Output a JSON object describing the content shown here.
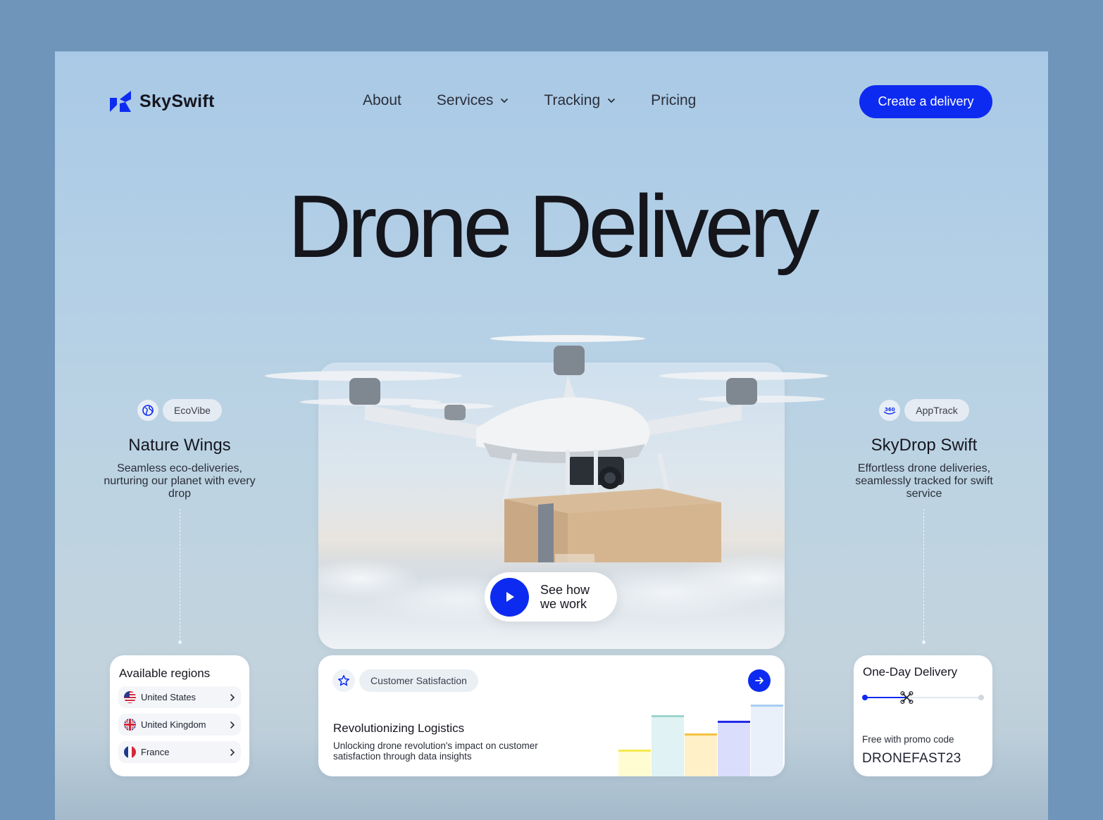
{
  "brand": {
    "name": "SkySwift",
    "accent": "#0D2BF0"
  },
  "nav": {
    "items": [
      {
        "label": "About",
        "has_dropdown": false
      },
      {
        "label": "Services",
        "has_dropdown": true
      },
      {
        "label": "Tracking",
        "has_dropdown": true
      },
      {
        "label": "Pricing",
        "has_dropdown": false
      }
    ],
    "cta_label": "Create a delivery"
  },
  "hero": {
    "title": "Drone Delivery",
    "play_text_line1": "See how",
    "play_text_line2": "we work"
  },
  "left_feature": {
    "chip": "EcoVibe",
    "icon": "globe-icon",
    "title": "Nature Wings",
    "description": "Seamless eco-deliveries, nurturing our planet with every drop"
  },
  "right_feature": {
    "chip": "AppTrack",
    "icon": "360-icon",
    "title": "SkyDrop Swift",
    "description": "Effortless drone deliveries, seamlessly tracked for swift service"
  },
  "regions": {
    "title": "Available regions",
    "items": [
      {
        "label": "United States",
        "flag": "us-flag-icon"
      },
      {
        "label": "United Kingdom",
        "flag": "uk-flag-icon"
      },
      {
        "label": "France",
        "flag": "fr-flag-icon"
      }
    ]
  },
  "logistics": {
    "chip": "Customer Satisfaction",
    "title": "Revolutionizing Logistics",
    "description": "Unlocking drone revolution's impact on customer satisfaction through data insights",
    "bar_colors": [
      "#FFFCD2",
      "#E0F2F3",
      "#FFF0C8",
      "#DADDFC",
      "#E9F0FA"
    ],
    "bar_accents": [
      "#F5E94E",
      "#9ED3CC",
      "#F2C240",
      "#2329E8",
      "#A9CDF0"
    ]
  },
  "delivery": {
    "title": "One-Day Delivery",
    "progress": 0.36,
    "promo_label": "Free with promo code",
    "promo_code": "DRONEFAST23"
  }
}
